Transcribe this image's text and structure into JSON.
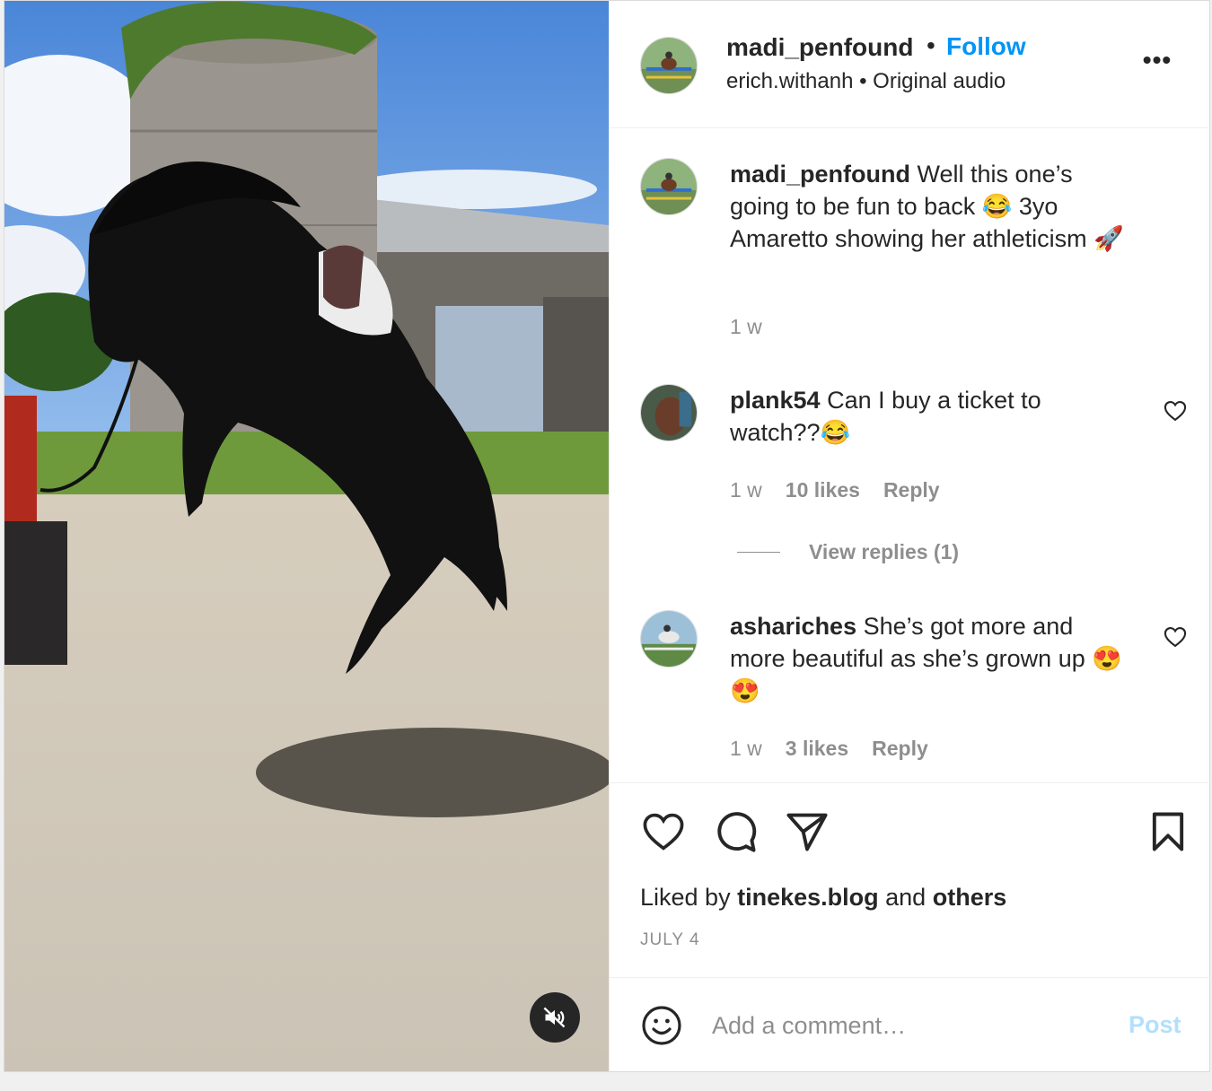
{
  "post": {
    "author": "madi_penfound",
    "dot": "•",
    "follow_label": "Follow",
    "audio_user": "erich.withanh",
    "audio_sep": "•",
    "audio_label": "Original audio",
    "more_label": "•••",
    "media_icons": {
      "mute": "speaker-muted-icon"
    }
  },
  "caption": {
    "username": "madi_penfound",
    "text": "Well this one’s going to be fun to back 😂 3yo Amaretto showing her athleticism 🚀",
    "time": "1 w"
  },
  "comments": [
    {
      "username": "plank54",
      "text": "Can I buy a ticket to watch??😂",
      "time": "1 w",
      "likes": "10 likes",
      "reply_label": "Reply"
    },
    {
      "username": "ashariches",
      "text": "She’s got more and more beautiful as she’s grown up 😍 😍",
      "time": "1 w",
      "likes": "3 likes",
      "reply_label": "Reply"
    }
  ],
  "view_replies": "View replies (1)",
  "actions": {
    "icons": [
      "heart-icon",
      "comment-icon",
      "share-icon",
      "bookmark-icon"
    ]
  },
  "likes": {
    "prefix": "Liked by",
    "user": "tinekes.blog",
    "and": "and",
    "others": "others"
  },
  "date": "JULY 4",
  "composer": {
    "placeholder": "Add a comment…",
    "post_label": "Post"
  },
  "colors": {
    "link": "#0095f6",
    "muted": "#8e8e8e",
    "post_disabled": "#b2dffc",
    "text": "#262626"
  }
}
